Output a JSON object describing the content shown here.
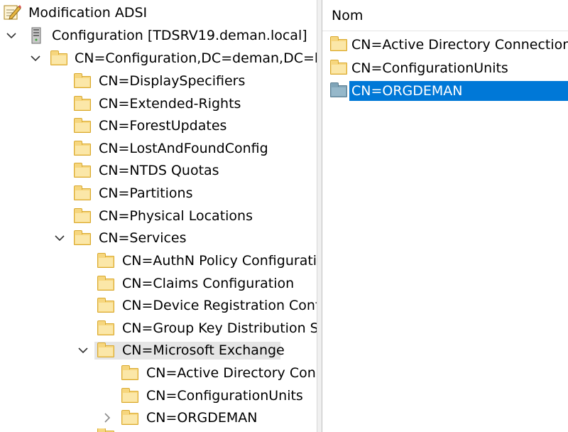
{
  "tree": {
    "root": {
      "label": "Modification ADSI"
    },
    "nodes": [
      {
        "id": "configuration",
        "label": "Configuration [TDSRV19.deman.local]",
        "icon": "server-icon",
        "expander": "expanded"
      },
      {
        "id": "cn-configuration",
        "label": "CN=Configuration,DC=deman,DC=local",
        "icon": "folder-icon",
        "expander": "expanded"
      },
      {
        "id": "display-specifiers",
        "label": "CN=DisplaySpecifiers",
        "icon": "folder-icon"
      },
      {
        "id": "extended-rights",
        "label": "CN=Extended-Rights",
        "icon": "folder-icon"
      },
      {
        "id": "forest-updates",
        "label": "CN=ForestUpdates",
        "icon": "folder-icon"
      },
      {
        "id": "lost-and-found",
        "label": "CN=LostAndFoundConfig",
        "icon": "folder-icon"
      },
      {
        "id": "ntds-quotas",
        "label": "CN=NTDS Quotas",
        "icon": "folder-icon"
      },
      {
        "id": "partitions",
        "label": "CN=Partitions",
        "icon": "folder-icon"
      },
      {
        "id": "physical-locations",
        "label": "CN=Physical Locations",
        "icon": "folder-icon"
      },
      {
        "id": "services",
        "label": "CN=Services",
        "icon": "folder-icon",
        "expander": "expanded"
      },
      {
        "id": "authn-policy",
        "label": "CN=AuthN Policy Configuration",
        "icon": "folder-icon"
      },
      {
        "id": "claims-configuration",
        "label": "CN=Claims Configuration",
        "icon": "folder-icon"
      },
      {
        "id": "device-registration",
        "label": "CN=Device Registration Configuration",
        "icon": "folder-icon"
      },
      {
        "id": "group-key-distribution",
        "label": "CN=Group Key Distribution Service",
        "icon": "folder-icon"
      },
      {
        "id": "microsoft-exchange",
        "label": "CN=Microsoft Exchange",
        "icon": "folder-icon",
        "expander": "expanded",
        "selected": true
      },
      {
        "id": "active-directory-connections",
        "label": "CN=Active Directory Connections",
        "icon": "folder-icon"
      },
      {
        "id": "configuration-units",
        "label": "CN=ConfigurationUnits",
        "icon": "folder-icon"
      },
      {
        "id": "orgdeman",
        "label": "CN=ORGDEMAN",
        "icon": "folder-icon",
        "expander": "collapsed"
      }
    ]
  },
  "list": {
    "header": "Nom",
    "items": [
      {
        "label": "CN=Active Directory Connections",
        "icon": "folder-icon"
      },
      {
        "label": "CN=ConfigurationUnits",
        "icon": "folder-icon"
      },
      {
        "label": "CN=ORGDEMAN",
        "icon": "folder-blue-icon",
        "selected": true
      }
    ]
  },
  "colors": {
    "selection_blue": "#0078d7",
    "selection_grey": "#e5e5e5",
    "folder_yellow": "#f6d67e",
    "folder_blue": "#7fa4b8"
  }
}
